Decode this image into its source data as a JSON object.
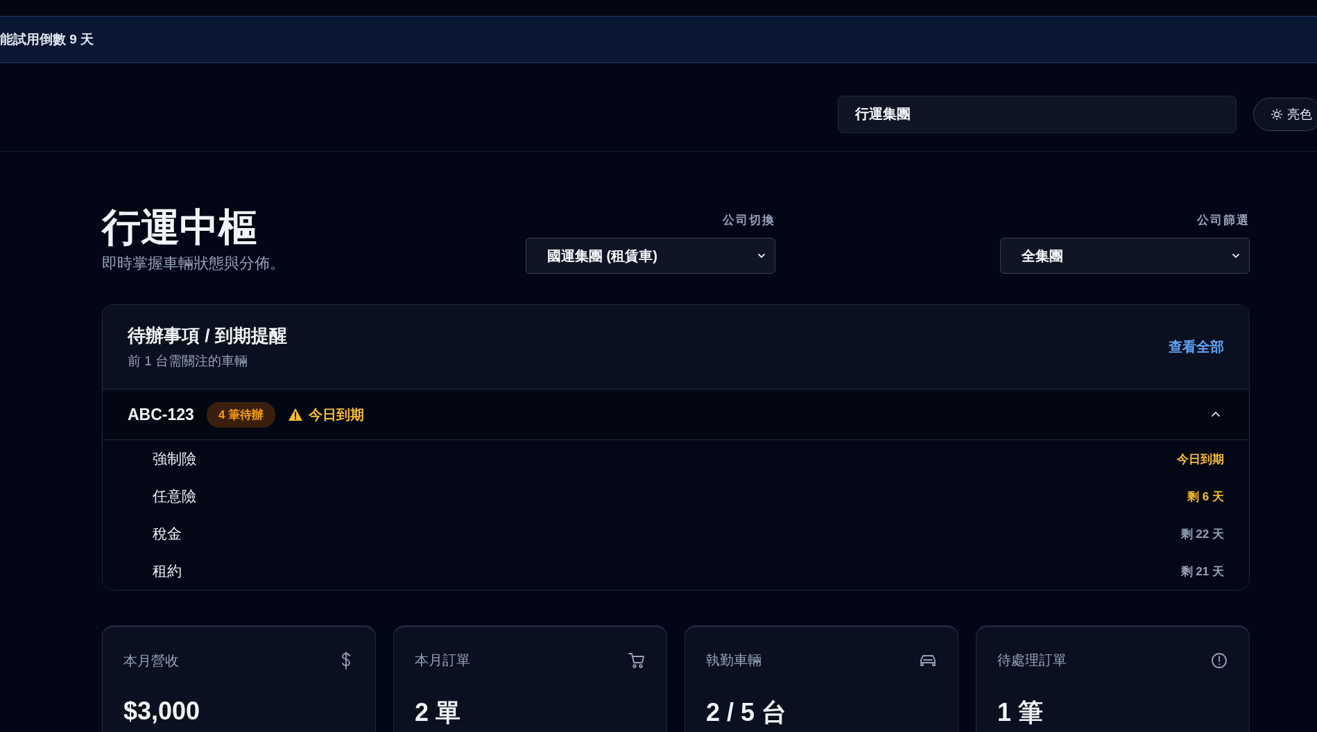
{
  "banner": {
    "text": "能試用倒數 9 天"
  },
  "header": {
    "org_field": {
      "value": "行運集團"
    },
    "theme_button": {
      "label": "亮色"
    }
  },
  "page": {
    "title": "行運中樞",
    "subtitle": "即時掌握車輛狀態與分佈。"
  },
  "filters": [
    {
      "label": "公司切換",
      "value": "國運集團 (租賃車)"
    },
    {
      "label": "公司篩選",
      "value": "全集團"
    }
  ],
  "todo": {
    "title": "待辦事項 / 到期提醒",
    "subtitle": "前 1 台需關注的車輛",
    "view_all": "查看全部",
    "vehicles": [
      {
        "plate": "ABC-123",
        "badge": "4 筆待辦",
        "alert": "今日到期",
        "expanded": true,
        "items": [
          {
            "name": "強制險",
            "due": "今日到期",
            "kind": "urgent"
          },
          {
            "name": "任意險",
            "due": "剩 6 天",
            "kind": "urgent"
          },
          {
            "name": "稅金",
            "due": "剩 22 天",
            "kind": "normal"
          },
          {
            "name": "租約",
            "due": "剩 21 天",
            "kind": "normal"
          }
        ]
      }
    ]
  },
  "stats": [
    {
      "label": "本月營收",
      "value": "$3,000",
      "kind": "revenue"
    },
    {
      "label": "本月訂單",
      "value": "2 單",
      "kind": "orders"
    },
    {
      "label": "執勤車輛",
      "value": "2 / 5 台",
      "kind": "vehicles"
    },
    {
      "label": "待處理訂單",
      "value": "1 筆",
      "kind": "pending"
    }
  ]
}
